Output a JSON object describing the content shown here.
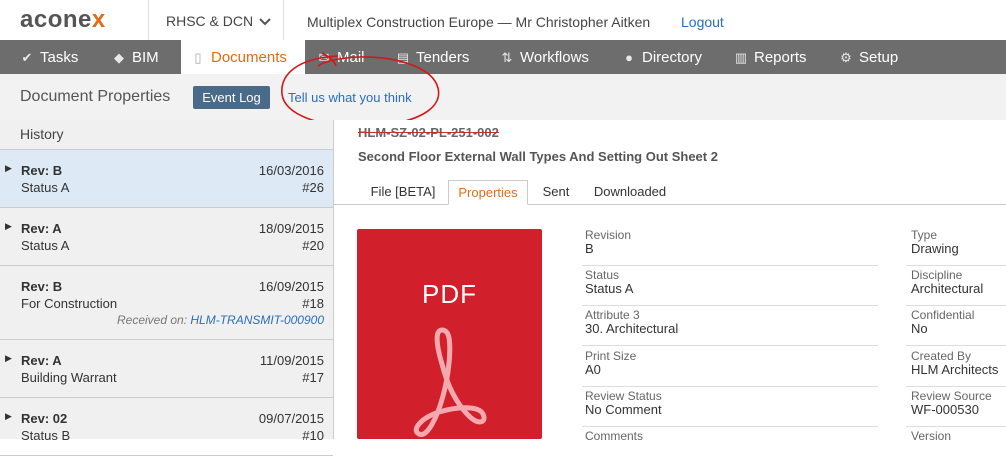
{
  "header": {
    "logo_text": "acone",
    "logo_x": "x",
    "project": "RHSC & DCN",
    "org_user": "Multiplex Construction Europe  —  Mr Christopher Aitken",
    "logout": "Logout"
  },
  "nav": {
    "items": [
      {
        "label": "Tasks",
        "icon": "check-icon"
      },
      {
        "label": "BIM",
        "icon": "cube-icon"
      },
      {
        "label": "Documents",
        "icon": "document-icon",
        "active": true
      },
      {
        "label": "Mail",
        "icon": "mail-icon"
      },
      {
        "label": "Tenders",
        "icon": "tender-icon"
      },
      {
        "label": "Workflows",
        "icon": "workflow-icon"
      },
      {
        "label": "Directory",
        "icon": "people-icon"
      },
      {
        "label": "Reports",
        "icon": "chart-icon"
      },
      {
        "label": "Setup",
        "icon": "gear-icon"
      }
    ]
  },
  "subheader": {
    "title": "Document Properties",
    "event_log": "Event Log",
    "feedback": "Tell us what you think"
  },
  "sidebar": {
    "heading": "History",
    "revisions": [
      {
        "rev": "Rev: B",
        "date": "16/03/2016",
        "status": "Status A",
        "num": "#26",
        "selected": true
      },
      {
        "rev": "Rev: A",
        "date": "18/09/2015",
        "status": "Status A",
        "num": "#20"
      },
      {
        "rev": "Rev: B",
        "date": "16/09/2015",
        "status": "For Construction",
        "num": "#18",
        "received_label": "Received on:",
        "received_link": "HLM-TRANSMIT-000900"
      },
      {
        "rev": "Rev: A",
        "date": "11/09/2015",
        "status": "Building Warrant",
        "num": "#17"
      },
      {
        "rev": "Rev: 02",
        "date": "09/07/2015",
        "status": "Status B",
        "num": "#10"
      }
    ]
  },
  "document": {
    "number": "HLM-SZ-02-PL-251-002",
    "title": "Second Floor External Wall Types And Setting Out Sheet 2",
    "tabs": [
      "File [BETA]",
      "Properties",
      "Sent",
      "Downloaded"
    ],
    "active_tab": "Properties",
    "preview_label": "PDF",
    "brand_color": "#d1202b",
    "properties_left": [
      {
        "label": "Revision",
        "value": "B"
      },
      {
        "label": "Status",
        "value": "Status A"
      },
      {
        "label": "Attribute 3",
        "value": "30. Architectural"
      },
      {
        "label": "Print Size",
        "value": "A0"
      },
      {
        "label": "Review Status",
        "value": "No Comment"
      },
      {
        "label": "Comments",
        "value": ""
      }
    ],
    "properties_right": [
      {
        "label": "Type",
        "value": "Drawing"
      },
      {
        "label": "Discipline",
        "value": "Architectural"
      },
      {
        "label": "Confidential",
        "value": "No"
      },
      {
        "label": "Created By",
        "value": "HLM Architects"
      },
      {
        "label": "Review Source",
        "value": "WF-000530"
      },
      {
        "label": "Version",
        "value": ""
      }
    ]
  }
}
